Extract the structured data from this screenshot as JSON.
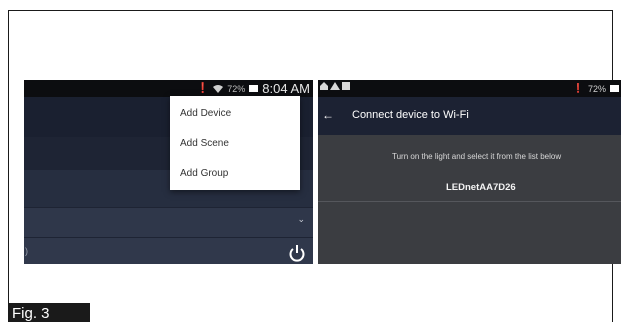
{
  "left_screen": {
    "status_time": "8:04 AM",
    "status_battery": "72%",
    "menu": [
      "Add Device",
      "Add Scene",
      "Add Group"
    ]
  },
  "right_screen": {
    "status_battery": "72%",
    "title": "Connect device to Wi-Fi",
    "instruction": "Turn on the light and select it from the list below",
    "device_name": "LEDnetAA7D26"
  },
  "caption": "Fig. 3",
  "icons": [
    "mute-icon",
    "wifi-icon",
    "battery-icon",
    "back-arrow-icon",
    "chevron-down-icon",
    "power-icon"
  ]
}
